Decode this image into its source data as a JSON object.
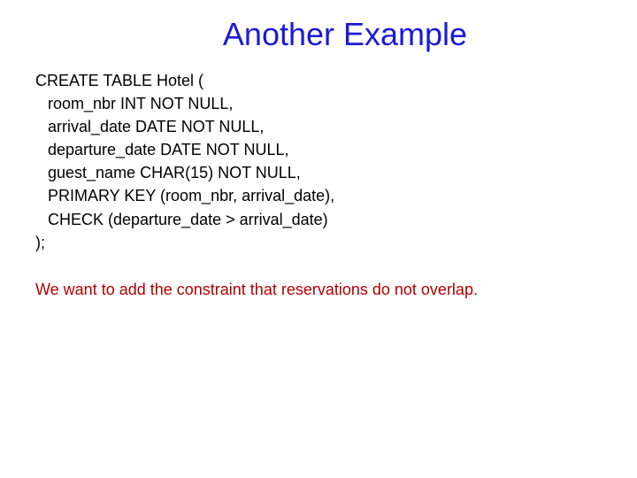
{
  "title": "Another Example",
  "code": {
    "l0": "CREATE TABLE Hotel (",
    "l1": "room_nbr INT NOT NULL,",
    "l2": "arrival_date DATE NOT NULL,",
    "l3": "departure_date DATE NOT NULL,",
    "l4": "guest_name CHAR(15) NOT NULL,",
    "l5": "PRIMARY KEY (room_nbr, arrival_date),",
    "l6": "CHECK (departure_date > arrival_date)",
    "l7": ");"
  },
  "note": "We want to add the constraint that reservations do not overlap."
}
